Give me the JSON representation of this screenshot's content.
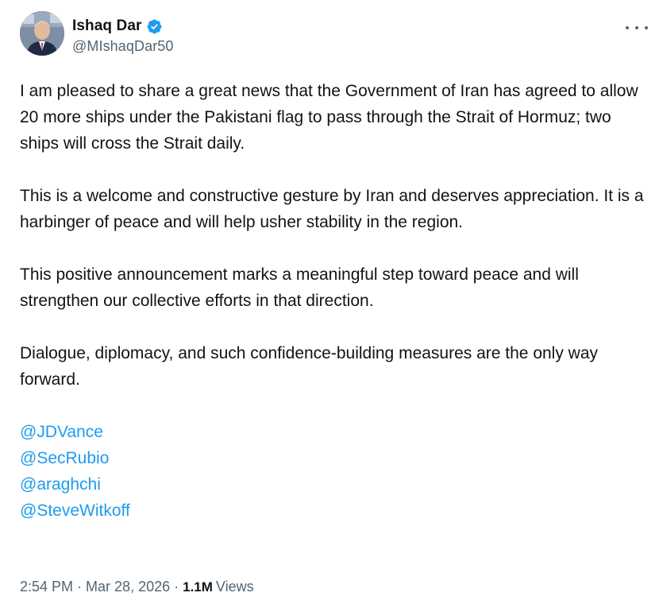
{
  "author": {
    "display_name": "Ishaq Dar",
    "handle": "@MIshaqDar50",
    "verified_color": "#1d9bf0"
  },
  "icons": {
    "verified": "verified-badge-icon",
    "more": "more-options-icon"
  },
  "tweet": {
    "paragraphs": [
      "I am pleased to share a great news that the Government of Iran has agreed to allow 20 more ships under the Pakistani flag to pass through the Strait of Hormuz; two ships will cross the Strait daily.",
      "This is a welcome and constructive gesture by Iran and deserves appreciation. It is a harbinger of peace and will help usher stability in the region.",
      "This positive announcement marks a meaningful step toward peace and will strengthen our collective efforts in that direction.",
      "Dialogue, diplomacy, and such confidence-building measures are the only way forward."
    ],
    "mentions": [
      "@JDVance",
      "@SecRubio",
      "@araghchi",
      "@SteveWitkoff"
    ],
    "mention_color": "#1d9bf0"
  },
  "meta": {
    "time": "2:54 PM",
    "separator": "·",
    "date": "Mar 28, 2026",
    "views_count": "1.1M",
    "views_label": "Views"
  }
}
